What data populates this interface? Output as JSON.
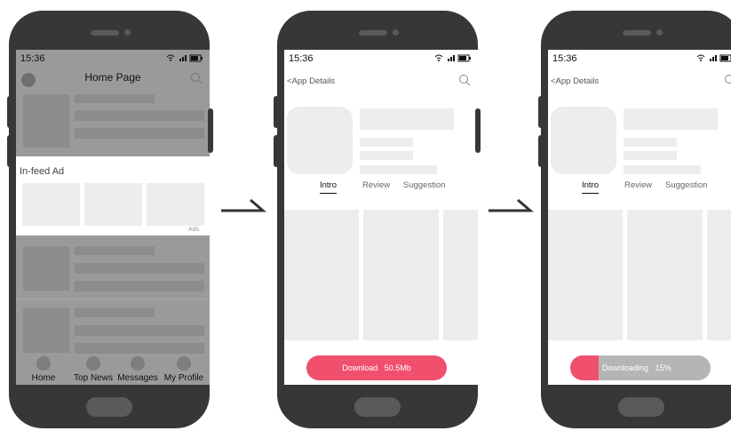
{
  "phone1": {
    "time": "15:36",
    "status_icons": "wifi signal battery",
    "page_title": "Home Page",
    "ad_label": "In-feed Ad",
    "ads_tag": "Ads.",
    "nav": [
      "Home",
      "Top News",
      "Messages",
      "My Profile"
    ]
  },
  "phone2": {
    "time": "15:36",
    "back_label": "<App Details",
    "tabs": [
      "Intro",
      "Review",
      "Suggestion"
    ],
    "download_label": "Download",
    "download_size": "50.5Mb"
  },
  "phone3": {
    "time": "15:36",
    "back_label": "<App Details",
    "tabs": [
      "Intro",
      "Review",
      "Suggestion"
    ],
    "downloading_label": "Downloading",
    "progress_text": "15%",
    "progress": 0.15
  },
  "colors": {
    "accent": "#f0506e",
    "frame": "#373737",
    "overlay": "#9a9a9a"
  }
}
